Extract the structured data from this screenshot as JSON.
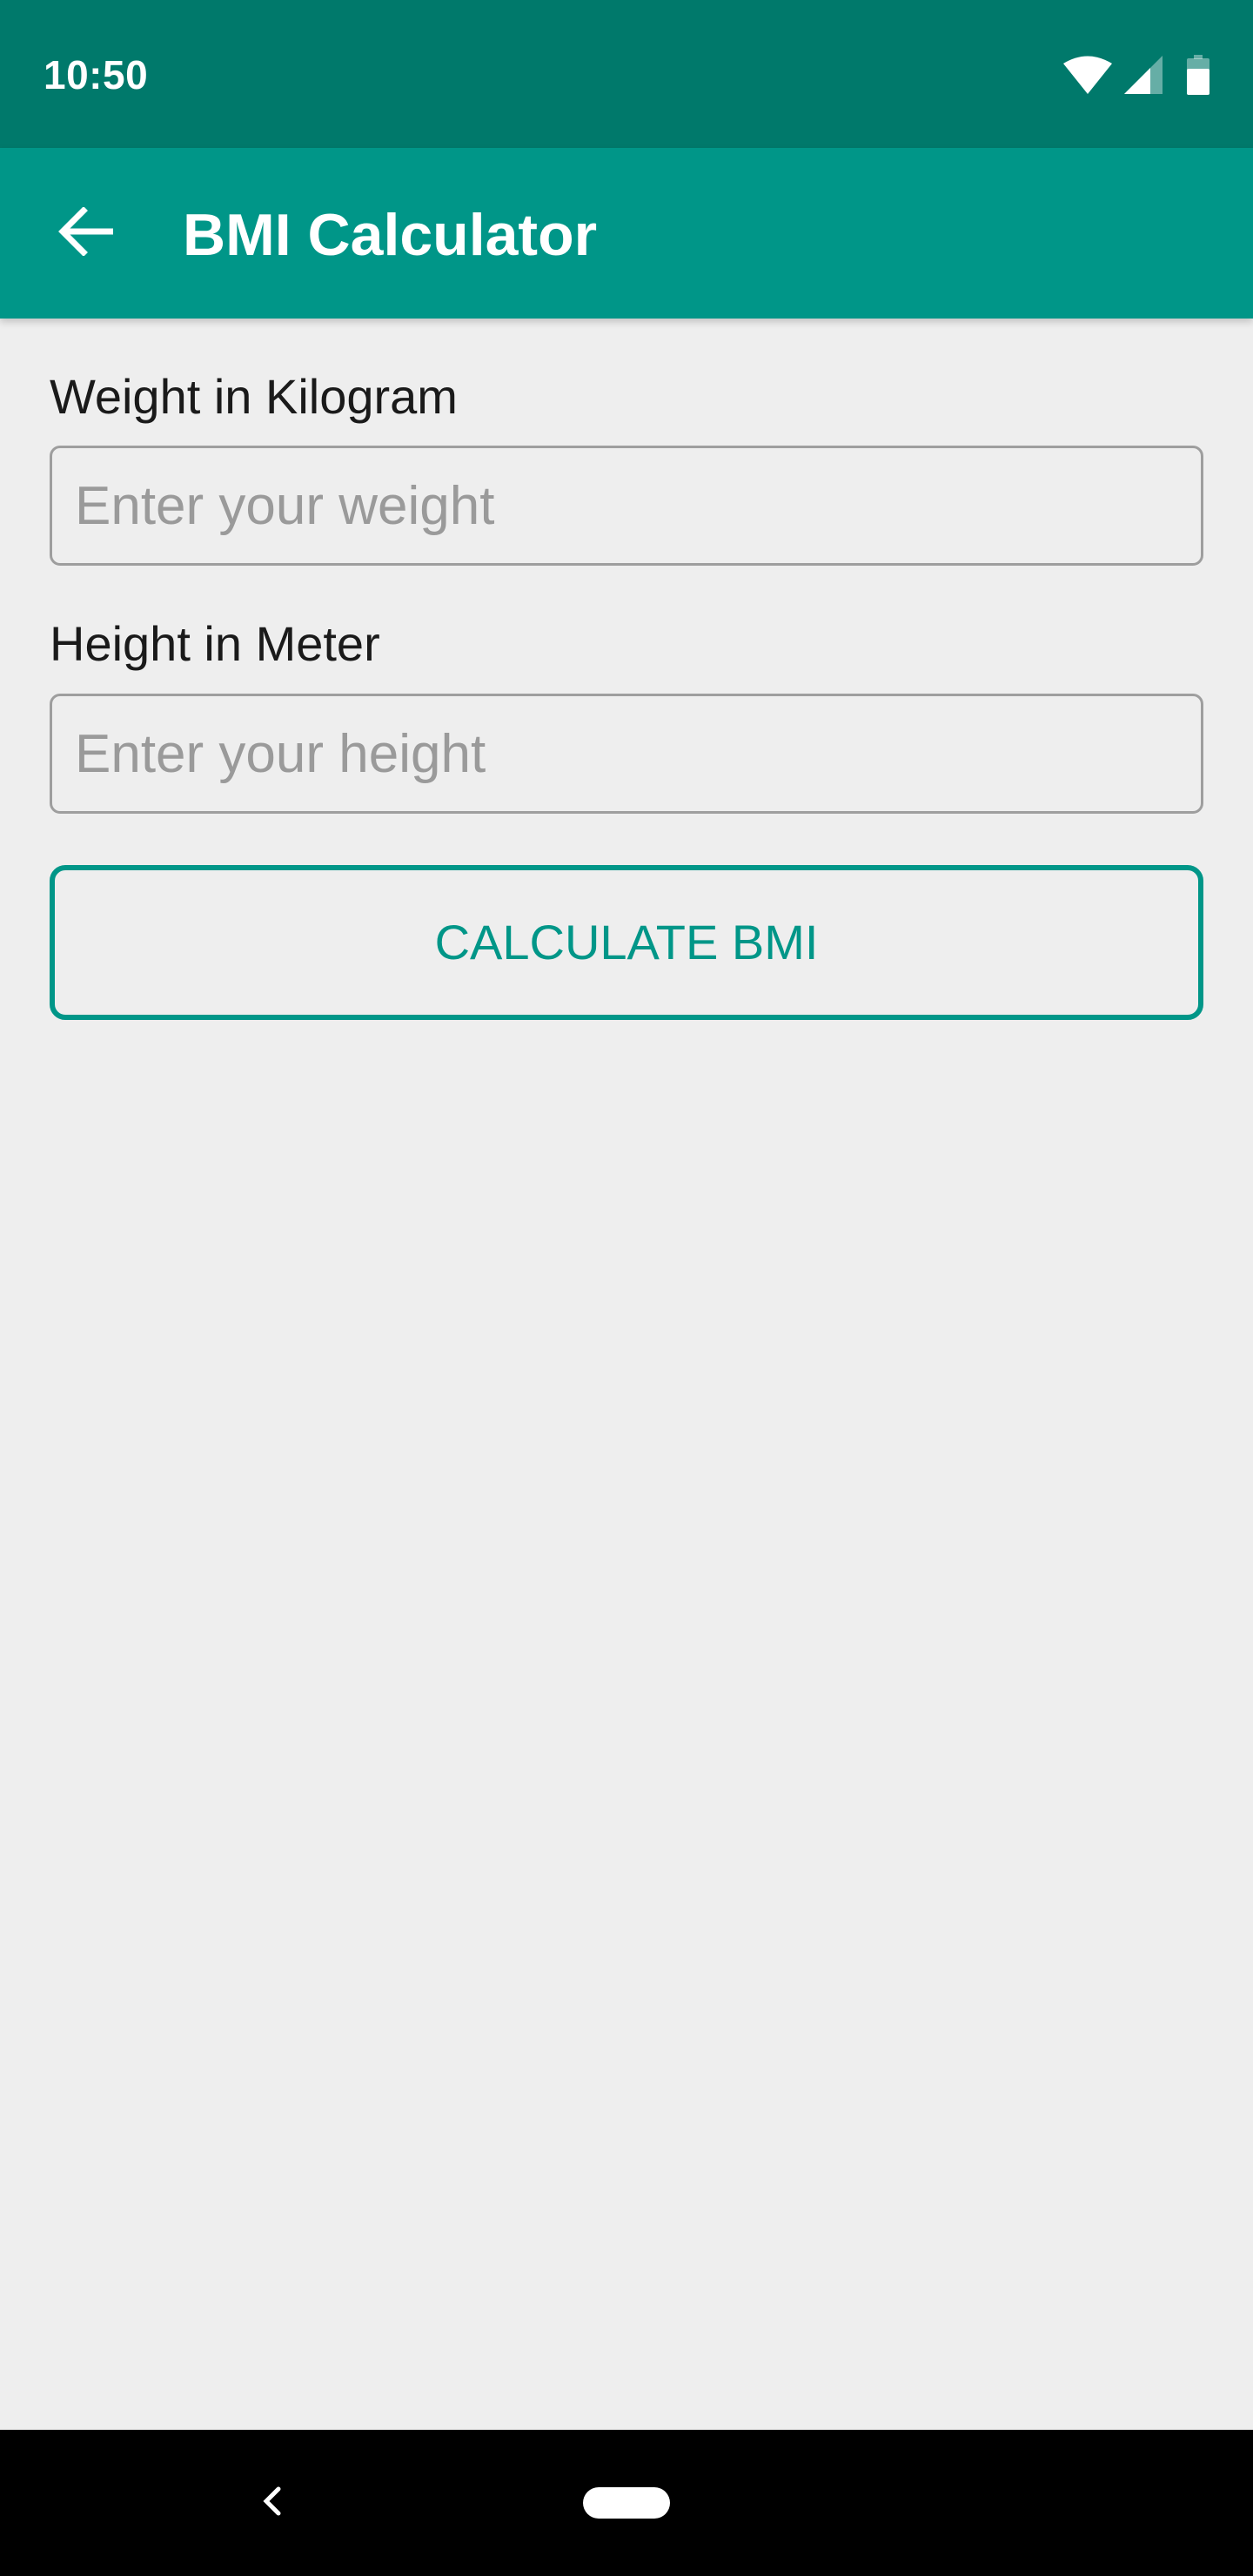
{
  "status_bar": {
    "time": "10:50",
    "icons": [
      "wifi-icon",
      "signal-icon",
      "battery-icon"
    ]
  },
  "app_bar": {
    "back_icon": "arrow-back-icon",
    "title": "BMI Calculator"
  },
  "form": {
    "weight": {
      "label": "Weight in Kilogram",
      "placeholder": "Enter your weight",
      "value": ""
    },
    "height": {
      "label": "Height in Meter",
      "placeholder": "Enter your height",
      "value": ""
    },
    "calculate_label": "CALCULATE BMI"
  },
  "nav_bar": {
    "icons": [
      "nav-back-icon",
      "nav-home-pill"
    ]
  },
  "colors": {
    "status_bar": "#00796b",
    "app_bar": "#009688",
    "accent": "#009688",
    "background": "#eeeeee"
  }
}
